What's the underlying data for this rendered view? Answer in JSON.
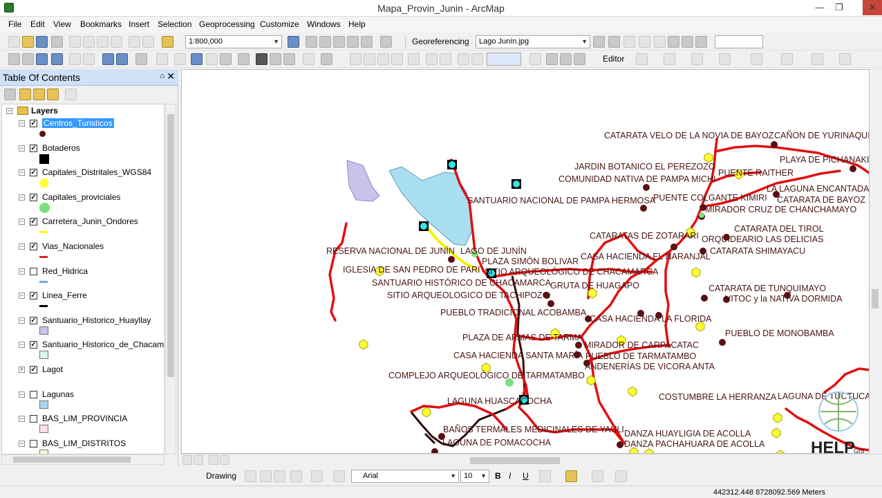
{
  "window": {
    "title": "Mapa_Provin_Junin - ArcMap",
    "minimize": "—",
    "maximize": "❐",
    "close": "✕"
  },
  "menu": [
    "File",
    "Edit",
    "View",
    "Bookmarks",
    "Insert",
    "Selection",
    "Geoprocessing",
    "Customize",
    "Windows",
    "Help"
  ],
  "toolbar": {
    "scale": "1:800,000",
    "georeferencing_label": "Georeferencing",
    "georef_layer": "Lago Junín.jpg",
    "editor_label": "Editor"
  },
  "toc": {
    "title": "Table Of Contents",
    "pin": "⌂",
    "close": "✕",
    "root": "Layers",
    "layers": [
      {
        "name": "Centros_Turisticos",
        "checked": true,
        "selected": true,
        "symbol": "dot",
        "color": "#5a1010"
      },
      {
        "name": "Botaderos",
        "checked": true,
        "symbol": "square",
        "color": "#000000"
      },
      {
        "name": "Capitales_Distritales_WGS84",
        "checked": true,
        "symbol": "hex",
        "color": "#ffff33"
      },
      {
        "name": "Capitales_proviciales",
        "checked": true,
        "symbol": "circle",
        "color": "#7be07b"
      },
      {
        "name": "Carretera_Junin_Ondores",
        "checked": true,
        "symbol": "line",
        "color": "#ffff00"
      },
      {
        "name": "Vias_Nacionales",
        "checked": true,
        "symbol": "line",
        "color": "#e02020"
      },
      {
        "name": "Red_Hidrica",
        "checked": false,
        "symbol": "line",
        "color": "#6fa8dc"
      },
      {
        "name": "Linea_Ferre",
        "checked": true,
        "symbol": "line",
        "color": "#000000"
      },
      {
        "name": "Santuario_Historico_Huayllay",
        "checked": true,
        "symbol": "poly",
        "color": "#c9c2ea"
      },
      {
        "name": "Santuario_Historico_de_Chacamarca",
        "checked": true,
        "symbol": "poly",
        "color": "#d8f3f0"
      },
      {
        "name": "Lagot",
        "checked": true,
        "symbol": "none",
        "color": "#ffffff"
      },
      {
        "name": "Lagunas",
        "checked": false,
        "symbol": "poly",
        "color": "#a9d7ee"
      },
      {
        "name": "BAS_LIM_PROVINCIA",
        "checked": false,
        "symbol": "poly",
        "color": "#fbe0ea"
      },
      {
        "name": "BAS_LIM_DISTRITOS",
        "checked": false,
        "symbol": "poly",
        "color": "#fbfbd0"
      }
    ]
  },
  "map_labels": [
    "CATARATA VELO DE LA NOVIA DE BAYOZ",
    "CAÑON DE YURINAQUI",
    "PLAYA DE PICHANAKI",
    "JARDIN BOTANICO EL PEREZOZO",
    "COMUNIDAD NATIVA DE PAMPA MICHI",
    "PUENTE RAITHER",
    "LA LAGUNA ENCANTADA",
    "CATARATA DE BAYOZ",
    "SANTUARIO NACIONAL DE PAMPA HERMOSA",
    "PUENTE COLGANTE KIMIRI",
    "MIRADOR CRUZ DE CHANCHAMAYO",
    "CATARATA DEL TIROL",
    "CATARATAS DE ZOTARARI",
    "ORQUIDEARIO LAS DELICIAS",
    "CATARATA SHIMAYACU",
    "RESERVA NACIONAL DE JUNÍN",
    "LAGO DE JUNÍN",
    "PLAZA SIMÓN BOLIVAR",
    "CASA HACIENDA EL NARANJAL",
    "IGLESIA DE SAN PEDRO DE PARI",
    "SITIO ARQUEOLÓGICO DE CHACAMARCA",
    "SANTUARIO HISTÓRICO DE CHACAMARCA",
    "GRUTA DE HUAGAPO",
    "CATARATA DE TUNQUIMAYO",
    "SITIO ARQUEOLOGICO DE TACHIPOZO",
    "VITOC y la NATIVA DORMIDA",
    "PUEBLO TRADICIONAL ACOBAMBA",
    "CASA HACIENDA LA FLORIDA",
    "PUEBLO DE MONOBAMBA",
    "PLAZA DE ARMAS DE TARMA",
    "MIRADOR DE CARPACATAC",
    "CASA HACIENDA SANTA MARÍA",
    "PUEBLO DE TARMATAMBO",
    "ANDENERÍAS DE VICORA ANTA",
    "COMPLEJO ARQUEOLÓGICO DE TARMATAMBO",
    "COSTUMBRE LA HERRANZA",
    "LAGUNA DE TUCTUCA",
    "LAGUNA HUASCACOCHA",
    "BAÑOS TERMALES MEDICINALES DE YAULI",
    "DANZA HUAYLIGIA DE ACOLLA",
    "LAGUNA DE POMACOCHA",
    "DANZA PACHAHUARA DE ACOLLA"
  ],
  "watermark": {
    "text": "HELP",
    "sub": "GIS"
  },
  "drawbar": {
    "drawing_label": "Drawing",
    "font": "Arial",
    "size": "10"
  },
  "status": {
    "coords": "442312.448  8728092.569 Meters"
  }
}
